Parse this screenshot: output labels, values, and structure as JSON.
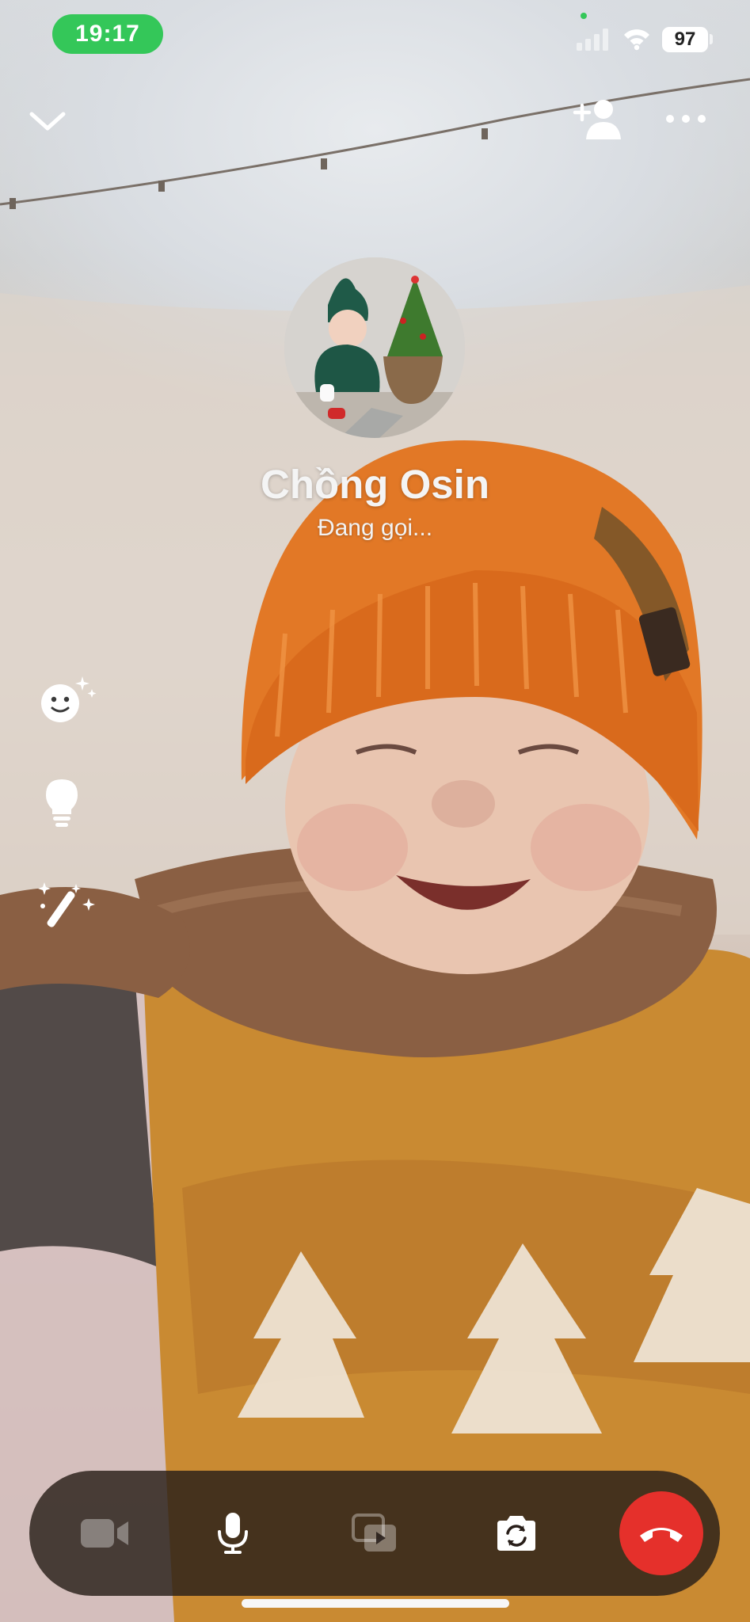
{
  "status_bar": {
    "time": "19:17",
    "battery": "97",
    "icons": [
      "signal-icon",
      "wifi-icon",
      "battery-icon"
    ]
  },
  "top_bar": {
    "icons": [
      "chevron-down-icon",
      "add-person-icon",
      "more-icon"
    ]
  },
  "caller": {
    "name": "Chồng Osin",
    "status": "Đang gọi..."
  },
  "side_tools": {
    "icons": [
      "face-effects-icon",
      "lightbulb-icon",
      "magic-wand-icon"
    ]
  },
  "controls": {
    "icons": [
      "video-camera-icon",
      "microphone-icon",
      "share-screen-icon",
      "camera-flip-icon",
      "end-call-icon"
    ],
    "video_enabled": false,
    "share_enabled": false
  },
  "colors": {
    "time_pill": "#34c759",
    "end_call": "#e5302b",
    "control_bar": "#281e19"
  }
}
